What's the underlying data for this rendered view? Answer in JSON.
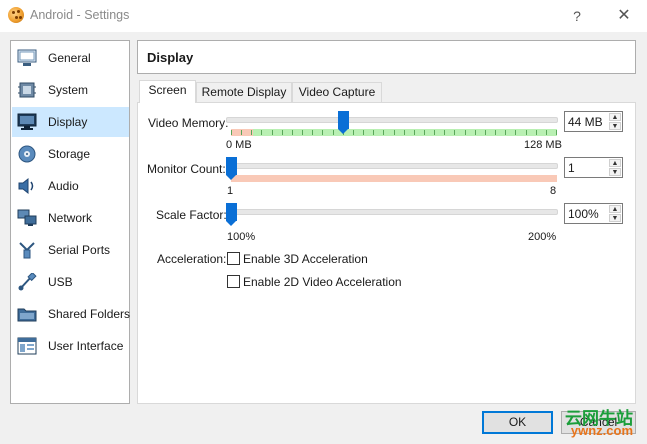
{
  "window": {
    "title": "Android - Settings",
    "help": "?",
    "close": "✕"
  },
  "sidebar": {
    "items": [
      {
        "label": "General",
        "icon": "general-icon"
      },
      {
        "label": "System",
        "icon": "system-icon"
      },
      {
        "label": "Display",
        "icon": "display-icon",
        "selected": true
      },
      {
        "label": "Storage",
        "icon": "storage-icon"
      },
      {
        "label": "Audio",
        "icon": "audio-icon"
      },
      {
        "label": "Network",
        "icon": "network-icon"
      },
      {
        "label": "Serial Ports",
        "icon": "serial-ports-icon"
      },
      {
        "label": "USB",
        "icon": "usb-icon"
      },
      {
        "label": "Shared Folders",
        "icon": "shared-folders-icon"
      },
      {
        "label": "User Interface",
        "icon": "user-interface-icon"
      }
    ]
  },
  "header": {
    "title": "Display"
  },
  "tabs": [
    {
      "label": "Screen",
      "active": true
    },
    {
      "label": "Remote Display",
      "active": false
    },
    {
      "label": "Video Capture",
      "active": false
    }
  ],
  "screen": {
    "video_memory": {
      "label": "Video Memory:",
      "min_label": "0 MB",
      "max_label": "128 MB",
      "value": "44 MB",
      "position": 0.35
    },
    "monitor_count": {
      "label": "Monitor Count:",
      "min_label": "1",
      "max_label": "8",
      "value": "1",
      "position": 0.0
    },
    "scale_factor": {
      "label": "Scale Factor:",
      "min_label": "100%",
      "max_label": "200%",
      "value": "100%",
      "position": 0.0
    },
    "acceleration": {
      "label": "Acceleration:",
      "options": [
        {
          "label": "Enable 3D Acceleration",
          "checked": false
        },
        {
          "label": "Enable 2D Video Acceleration",
          "checked": false
        }
      ]
    }
  },
  "buttons": {
    "ok": "OK",
    "cancel": "Cancel"
  },
  "watermark": {
    "line1": "云网牛站",
    "line2": "ywnz.com"
  },
  "colors": {
    "selection": "#cce8ff",
    "accent": "#0a6fd6",
    "green_zone": "#b9f0b3",
    "red_zone": "#f9c9b7"
  }
}
